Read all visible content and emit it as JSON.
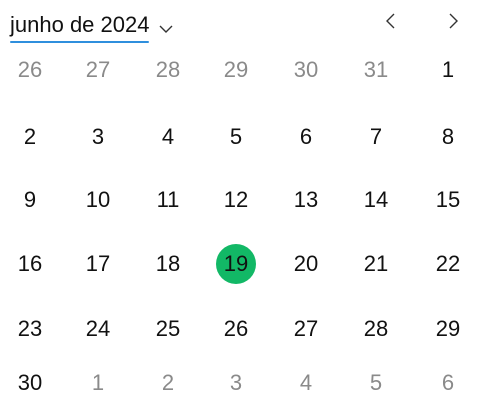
{
  "header": {
    "month_label": "junho de 2024",
    "underline_color": "#2f8fdd",
    "icons": {
      "dropdown": "chevron-down-icon",
      "prev": "chevron-left-icon",
      "next": "chevron-right-icon"
    }
  },
  "calendar": {
    "selected_day": "19",
    "selected_color": "#12b866",
    "weeks": [
      [
        {
          "d": "26",
          "out": true
        },
        {
          "d": "27",
          "out": true
        },
        {
          "d": "28",
          "out": true
        },
        {
          "d": "29",
          "out": true
        },
        {
          "d": "30",
          "out": true
        },
        {
          "d": "31",
          "out": true
        },
        {
          "d": "1",
          "out": false
        }
      ],
      [
        {
          "d": "2",
          "out": false
        },
        {
          "d": "3",
          "out": false
        },
        {
          "d": "4",
          "out": false
        },
        {
          "d": "5",
          "out": false
        },
        {
          "d": "6",
          "out": false
        },
        {
          "d": "7",
          "out": false
        },
        {
          "d": "8",
          "out": false
        }
      ],
      [
        {
          "d": "9",
          "out": false
        },
        {
          "d": "10",
          "out": false
        },
        {
          "d": "11",
          "out": false
        },
        {
          "d": "12",
          "out": false
        },
        {
          "d": "13",
          "out": false
        },
        {
          "d": "14",
          "out": false
        },
        {
          "d": "15",
          "out": false
        }
      ],
      [
        {
          "d": "16",
          "out": false
        },
        {
          "d": "17",
          "out": false
        },
        {
          "d": "18",
          "out": false
        },
        {
          "d": "19",
          "out": false,
          "selected": true
        },
        {
          "d": "20",
          "out": false
        },
        {
          "d": "21",
          "out": false
        },
        {
          "d": "22",
          "out": false
        }
      ],
      [
        {
          "d": "23",
          "out": false
        },
        {
          "d": "24",
          "out": false
        },
        {
          "d": "25",
          "out": false
        },
        {
          "d": "26",
          "out": false
        },
        {
          "d": "27",
          "out": false
        },
        {
          "d": "28",
          "out": false
        },
        {
          "d": "29",
          "out": false
        }
      ],
      [
        {
          "d": "30",
          "out": false
        },
        {
          "d": "1",
          "out": true
        },
        {
          "d": "2",
          "out": true
        },
        {
          "d": "3",
          "out": true
        },
        {
          "d": "4",
          "out": true
        },
        {
          "d": "5",
          "out": true
        },
        {
          "d": "6",
          "out": true
        }
      ]
    ]
  }
}
